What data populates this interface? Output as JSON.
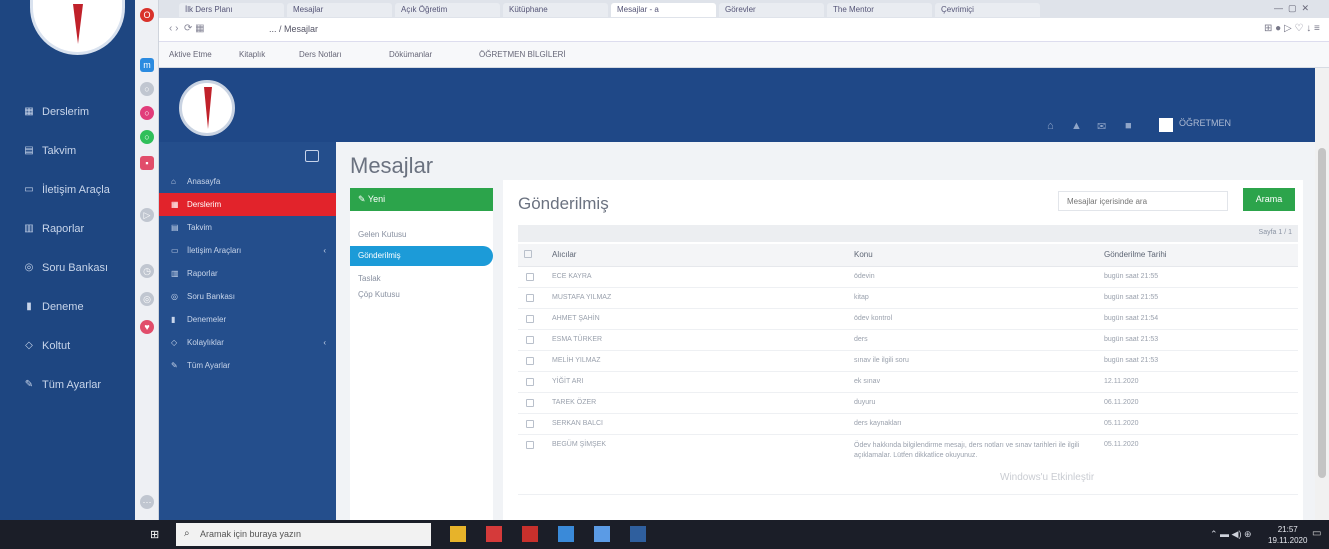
{
  "outer_sidebar": {
    "items": [
      {
        "icon": "grid-icon",
        "label": "Derslerim"
      },
      {
        "icon": "calendar-icon",
        "label": "Takvim"
      },
      {
        "icon": "chat-icon",
        "label": "İletişim Araçla"
      },
      {
        "icon": "chart-icon",
        "label": "Raporlar"
      },
      {
        "icon": "database-icon",
        "label": "Soru Bankası"
      },
      {
        "icon": "exam-icon",
        "label": "Deneme"
      },
      {
        "icon": "users-icon",
        "label": "Koltut"
      },
      {
        "icon": "wrench-icon",
        "label": "Tüm Ayarlar"
      }
    ]
  },
  "browser": {
    "tabs": [
      "İlk Ders Planı",
      "Mesajlar",
      "Açık Öğretim",
      "Kütüphane",
      "Mesajlar - a",
      "Görevler",
      "The Mentor",
      "Çevrimiçi"
    ],
    "active_tab_index": 4,
    "url": "... / Mesajlar",
    "bookmarks": [
      "Aktive Etme",
      "Kitaplık",
      "Ders Notları",
      "Dökümanlar",
      "ÖĞRETMEN BİLGİLERİ"
    ]
  },
  "header": {
    "user_name": "ÖĞRETMEN"
  },
  "app_sidebar": {
    "items": [
      {
        "icon": "home-icon",
        "label": "Anasayfa",
        "active": false,
        "has_children": false
      },
      {
        "icon": "grid-icon",
        "label": "Derslerim",
        "active": true,
        "has_children": false
      },
      {
        "icon": "calendar-icon",
        "label": "Takvim",
        "active": false,
        "has_children": false
      },
      {
        "icon": "chat-icon",
        "label": "İletişim Araçları",
        "active": false,
        "has_children": true
      },
      {
        "icon": "chart-icon",
        "label": "Raporlar",
        "active": false,
        "has_children": false
      },
      {
        "icon": "database-icon",
        "label": "Soru Bankası",
        "active": false,
        "has_children": false
      },
      {
        "icon": "exam-icon",
        "label": "Denemeler",
        "active": false,
        "has_children": false
      },
      {
        "icon": "users-icon",
        "label": "Kolaylıklar",
        "active": false,
        "has_children": true
      },
      {
        "icon": "wrench-icon",
        "label": "Tüm Ayarlar",
        "active": false,
        "has_children": false
      }
    ]
  },
  "page": {
    "title": "Mesajlar",
    "new_button": "Yeni",
    "folders": [
      "Gelen Kutusu",
      "Gönderilmiş",
      "Taslak",
      "Çöp Kutusu"
    ],
    "active_folder_index": 1
  },
  "panel": {
    "title": "Gönderilmiş",
    "search_placeholder": "Mesajlar içerisinde ara",
    "search_button": "Arama",
    "pager": "Sayfa 1 / 1",
    "columns": [
      "Alıcılar",
      "Konu",
      "Gönderilme Tarihi"
    ],
    "rows": [
      {
        "recipient": "ECE KAYRA",
        "subject": "ödevin",
        "date": "bugün saat 21:55"
      },
      {
        "recipient": "MUSTAFA YILMAZ",
        "subject": "kitap",
        "date": "bugün saat 21:55"
      },
      {
        "recipient": "AHMET ŞAHİN",
        "subject": "ödev kontrol",
        "date": "bugün saat 21:54"
      },
      {
        "recipient": "ESMA TÜRKER",
        "subject": "ders",
        "date": "bugün saat 21:53"
      },
      {
        "recipient": "MELİH YILMAZ",
        "subject": "sınav ile ilgili soru",
        "date": "bugün saat 21:53"
      },
      {
        "recipient": "YİĞİT ARI",
        "subject": "ek sınav",
        "date": "12.11.2020"
      },
      {
        "recipient": "TAREK ÖZER",
        "subject": "duyuru",
        "date": "06.11.2020"
      },
      {
        "recipient": "SERKAN BALCI",
        "subject": "ders kaynakları",
        "date": "05.11.2020"
      },
      {
        "recipient": "BEGÜM ŞİMŞEK",
        "subject": "Ödev hakkında bilgilendirme mesajı, ders notları ve sınav tarihleri ile ilgili açıklamalar. Lütfen dikkatlice okuyunuz.",
        "date": "05.11.2020"
      }
    ]
  },
  "taskbar": {
    "search_placeholder": "Aramak için buraya yazın",
    "clock_time": "21:57",
    "clock_date": "19.11.2020"
  },
  "watermark": "Windows'u Etkinleştir",
  "colors": {
    "brand_blue": "#1f4887",
    "active_red": "#e2232b",
    "action_green": "#2ca44b",
    "folder_active": "#1c9bd8"
  }
}
